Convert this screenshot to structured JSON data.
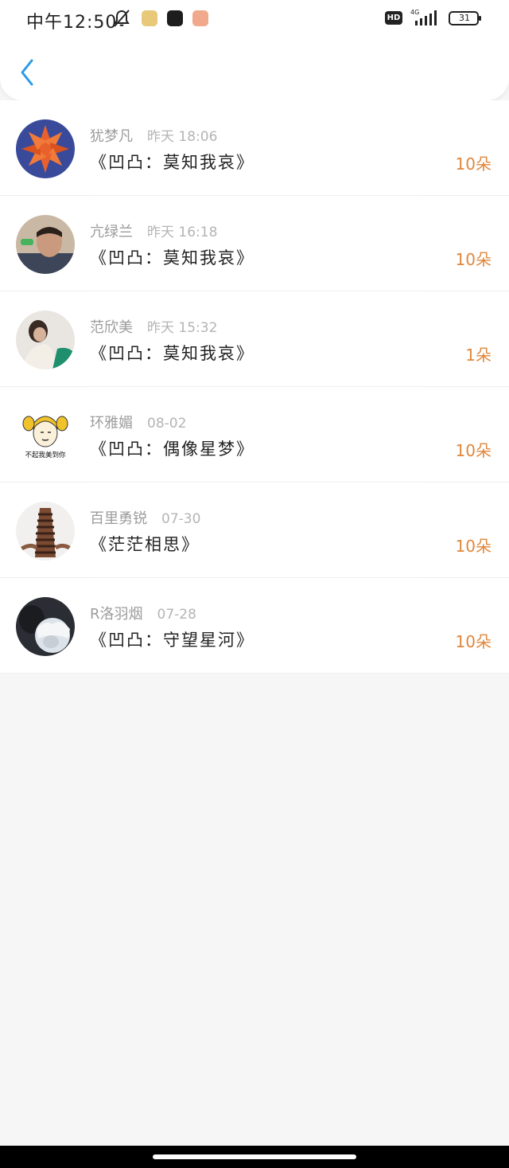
{
  "status_bar": {
    "time": "中午12:50",
    "hd": "HD",
    "network": "4G",
    "battery": "31"
  },
  "nav": {
    "back_icon": "chevron-left-icon",
    "accent": "#2b9be5"
  },
  "gifts": [
    {
      "name": "犹梦凡",
      "time": "昨天 18:06",
      "title": "《凹凸：莫知我哀》",
      "amount": "10朵"
    },
    {
      "name": "亢绿兰",
      "time": "昨天 16:18",
      "title": "《凹凸：莫知我哀》",
      "amount": "10朵"
    },
    {
      "name": "范欣美",
      "time": "昨天 15:32",
      "title": "《凹凸：莫知我哀》",
      "amount": "1朵"
    },
    {
      "name": "环雅媚",
      "time": "08-02",
      "title": "《凹凸：偶像星梦》",
      "amount": "10朵",
      "avatar_caption": "不起我美到你"
    },
    {
      "name": "百里勇锐",
      "time": "07-30",
      "title": "《茫茫相思》",
      "amount": "10朵"
    },
    {
      "name": "R洛羽烟",
      "time": "07-28",
      "title": "《凹凸：守望星河》",
      "amount": "10朵"
    }
  ],
  "colors": {
    "amount": "#e0873c",
    "name": "#9c9c9c",
    "title": "#222222"
  }
}
